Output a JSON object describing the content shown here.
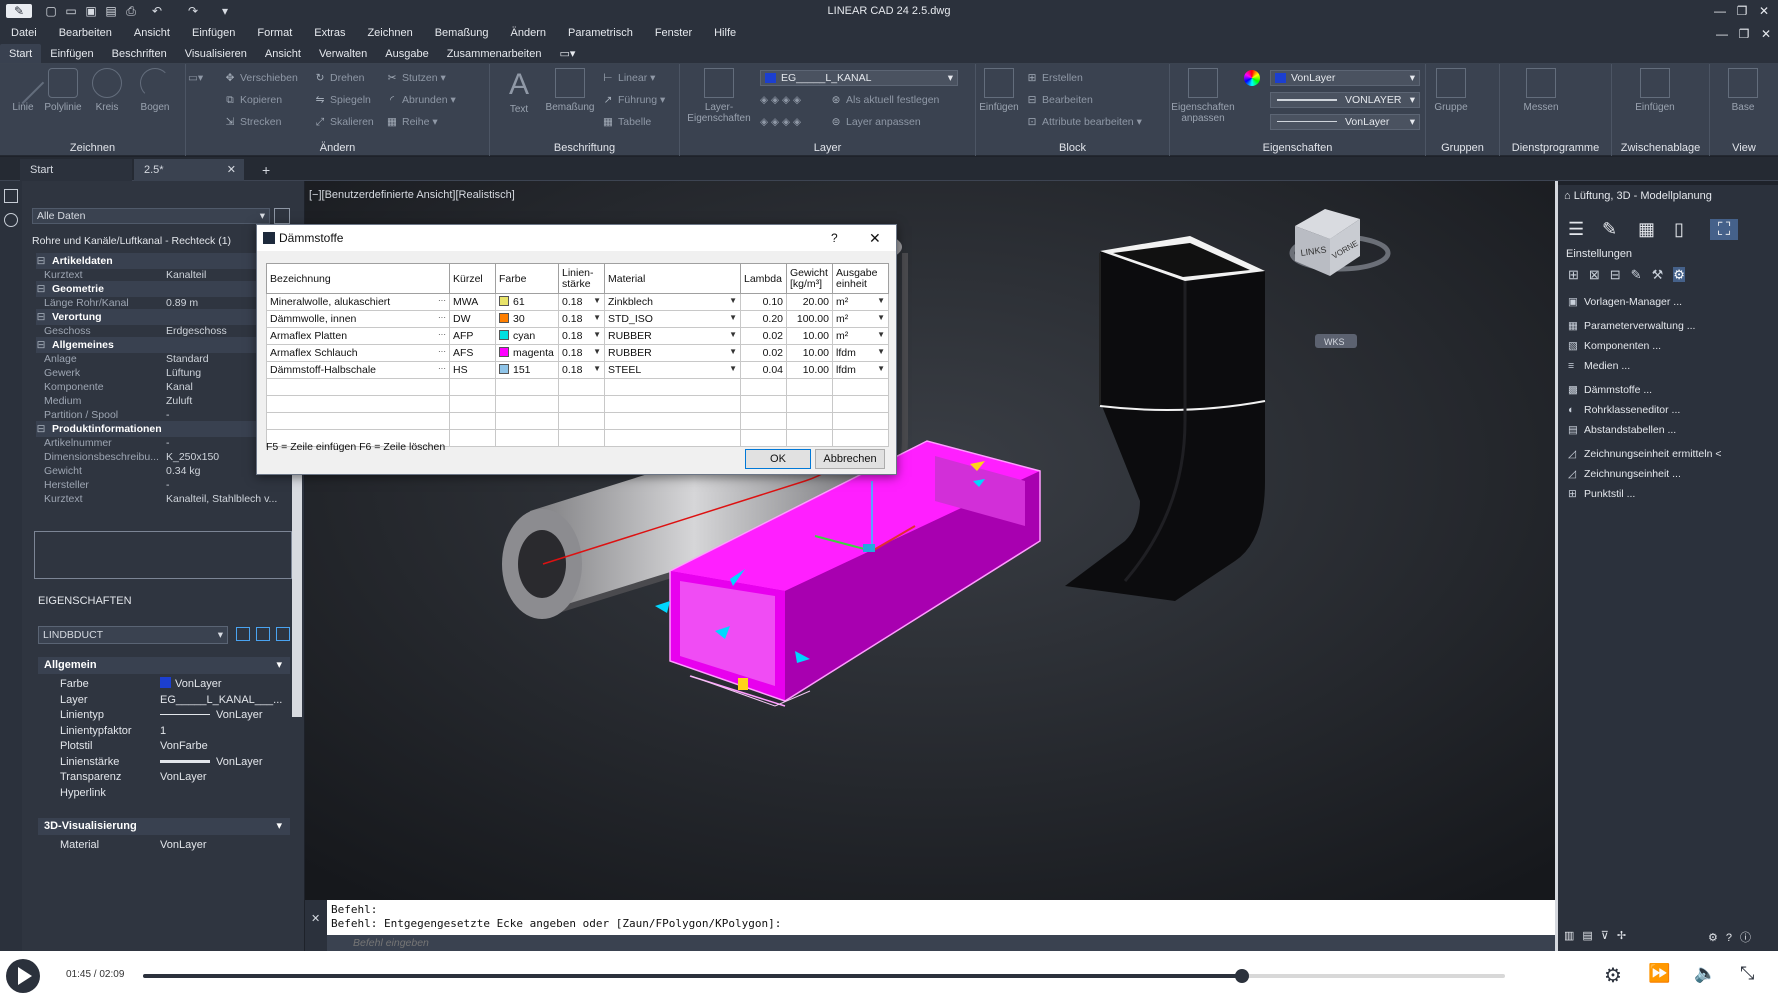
{
  "app": {
    "title": "LINEAR CAD 24   2.5.dwg"
  },
  "menubar": [
    "Datei",
    "Bearbeiten",
    "Ansicht",
    "Einfügen",
    "Format",
    "Extras",
    "Zeichnen",
    "Bemaßung",
    "Ändern",
    "Parametrisch",
    "Fenster",
    "Hilfe"
  ],
  "ribbon_tabs": [
    "Start",
    "Einfügen",
    "Beschriften",
    "Visualisieren",
    "Ansicht",
    "Verwalten",
    "Ausgabe",
    "Zusammenarbeiten"
  ],
  "ribbon": {
    "zeichnen": {
      "label": "Zeichnen",
      "tools": [
        "Linie",
        "Polylinie",
        "Kreis",
        "Bogen"
      ]
    },
    "aendern": {
      "label": "Ändern",
      "tools": [
        "Verschieben",
        "Drehen",
        "Stutzen",
        "Kopieren",
        "Spiegeln",
        "Abrunden",
        "Strecken",
        "Skalieren",
        "Reihe"
      ]
    },
    "beschriftung": {
      "label": "Beschriftung",
      "tools": [
        "Text",
        "Bemaßung",
        "Linear",
        "Führung",
        "Tabelle"
      ]
    },
    "layer": {
      "label": "Layer",
      "big": "Layer-\nEigenschaften",
      "combo": "EG_____L_KANAL",
      "actions": [
        "Als aktuell festlegen",
        "Layer anpassen"
      ]
    },
    "block": {
      "label": "Block",
      "big": "Einfügen",
      "actions": [
        "Erstellen",
        "Bearbeiten",
        "Attribute bearbeiten"
      ]
    },
    "eigenschaften": {
      "label": "Eigenschaften",
      "big": "Eigenschaften\nanpassen",
      "combos": [
        "VonLayer",
        "VONLAYER",
        "VonLayer"
      ]
    },
    "gruppen": {
      "label": "Gruppen",
      "big": "Gruppe"
    },
    "dienst": {
      "label": "Dienstprogramme",
      "big": "Messen"
    },
    "zwischen": {
      "label": "Zwischenablage",
      "big": "Einfügen"
    },
    "view": {
      "label": "View",
      "big": "Base"
    }
  },
  "doc_tabs": [
    "Start",
    "2.5*"
  ],
  "left_panel": {
    "filter": "Alle Daten",
    "object": "Rohre und Kanäle/Luftkanal - Rechteck (1)",
    "rows": [
      {
        "type": "sec",
        "label": "Artikeldaten"
      },
      {
        "type": "row",
        "k": "Kurztext",
        "v": "Kanalteil"
      },
      {
        "type": "sec",
        "label": "Geometrie"
      },
      {
        "type": "row",
        "k": "Länge Rohr/Kanal",
        "v": "0.89 m"
      },
      {
        "type": "sec",
        "label": "Verortung"
      },
      {
        "type": "row",
        "k": "Geschoss",
        "v": "Erdgeschoss"
      },
      {
        "type": "sec",
        "label": "Allgemeines"
      },
      {
        "type": "row",
        "k": "Anlage",
        "v": "Standard"
      },
      {
        "type": "row",
        "k": "Gewerk",
        "v": "Lüftung"
      },
      {
        "type": "row",
        "k": "Komponente",
        "v": "Kanal"
      },
      {
        "type": "row",
        "k": "Medium",
        "v": "Zuluft"
      },
      {
        "type": "row",
        "k": "Partition / Spool",
        "v": "-"
      },
      {
        "type": "sec",
        "label": "Produktinformationen"
      },
      {
        "type": "row",
        "k": "Artikelnummer",
        "v": "-"
      },
      {
        "type": "row",
        "k": "Dimensionsbeschreibu...",
        "v": "K_250x150"
      },
      {
        "type": "row",
        "k": "Gewicht",
        "v": "0.34 kg"
      },
      {
        "type": "row",
        "k": "Hersteller",
        "v": "-"
      },
      {
        "type": "row",
        "k": "Kurztext",
        "v": "Kanalteil, Stahlblech v..."
      }
    ]
  },
  "eigenschaften": {
    "title": "EIGENSCHAFTEN",
    "selector": "LINDBDUCT",
    "allgemein": "Allgemein",
    "rows": [
      {
        "k": "Farbe",
        "v": "VonLayer"
      },
      {
        "k": "Layer",
        "v": "EG_____L_KANAL___..."
      },
      {
        "k": "Linientyp",
        "v": "VonLayer"
      },
      {
        "k": "Linientypfaktor",
        "v": "1"
      },
      {
        "k": "Plotstil",
        "v": "VonFarbe"
      },
      {
        "k": "Linienstärke",
        "v": "VonLayer"
      },
      {
        "k": "Transparenz",
        "v": "VonLayer"
      },
      {
        "k": "Hyperlink",
        "v": ""
      }
    ],
    "vis": "3D-Visualisierung",
    "material_k": "Material",
    "material_v": "VonLayer"
  },
  "viewport": {
    "label": "[−][Benutzerdefinierte Ansicht][Realistisch]",
    "viewcube": {
      "left": "LINKS",
      "front": "VORNE"
    },
    "wcs": "WKS"
  },
  "dialog": {
    "title": "Dämmstoffe",
    "help": "?",
    "headers": [
      "Bezeichnung",
      "Kürzel",
      "Farbe",
      "Linien-\nstärke",
      "Material",
      "Lambda",
      "Gewicht\n[kg/m³]",
      "Ausgabe\neinheit"
    ],
    "rows": [
      {
        "name": "Mineralwolle, alukaschiert",
        "code": "MWA",
        "color": "61",
        "hex": "#e8e36a",
        "lw": "0.18",
        "mat": "Zinkblech",
        "lambda": "0.10",
        "weight": "20.00",
        "unit": "m²"
      },
      {
        "name": "Dämmwolle, innen",
        "code": "DW",
        "color": "30",
        "hex": "#ff7f00",
        "lw": "0.18",
        "mat": "STD_ISO",
        "lambda": "0.20",
        "weight": "100.00",
        "unit": "m²"
      },
      {
        "name": "Armaflex Platten",
        "code": "AFP",
        "color": "cyan",
        "hex": "#00e0e0",
        "lw": "0.18",
        "mat": "RUBBER",
        "lambda": "0.02",
        "weight": "10.00",
        "unit": "m²"
      },
      {
        "name": "Armaflex Schlauch",
        "code": "AFS",
        "color": "magenta",
        "hex": "#ff00ff",
        "lw": "0.18",
        "mat": "RUBBER",
        "lambda": "0.02",
        "weight": "10.00",
        "unit": "lfdm"
      },
      {
        "name": "Dämmstoff-Halbschale",
        "code": "HS",
        "color": "151",
        "hex": "#8fc4e8",
        "lw": "0.18",
        "mat": "STEEL",
        "lambda": "0.04",
        "weight": "10.00",
        "unit": "lfdm"
      }
    ],
    "hint": "F5 = Zeile einfügen   F6 = Zeile löschen",
    "ok": "OK",
    "cancel": "Abbrechen"
  },
  "command": {
    "line1": "Befehl:",
    "line2": "Befehl: Entgegengesetzte Ecke angeben oder [Zaun/FPolygon/KPolygon]:",
    "placeholder": "Befehl eingeben"
  },
  "right_panel": {
    "title": "Lüftung, 3D - Modellplanung",
    "section": "Einstellungen",
    "items": [
      "Vorlagen-Manager ...",
      "Parameterverwaltung ...",
      "Komponenten ...",
      "Medien ...",
      "Dämmstoffe ...",
      "Rohrklasseneditor ...",
      "Abstandstabellen ...",
      "Zeichnungseinheit ermitteln <",
      "Zeichnungseinheit ...",
      "Punktstil ..."
    ]
  },
  "player": {
    "time": "01:45 / 02:09",
    "progress": 0.807
  },
  "colors": {
    "accent": "#ff00ff",
    "layer_blue": "#1c3fd0",
    "ui_dark": "#2b313c"
  }
}
